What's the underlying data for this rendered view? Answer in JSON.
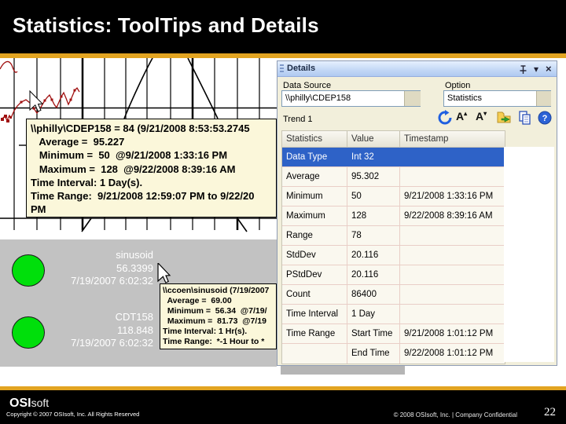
{
  "slide": {
    "title": "Statistics: ToolTips and Details",
    "page_number": "22",
    "footer": {
      "logo_bold": "OSI",
      "logo_light": "soft",
      "copyright": "Copyright © 2007 OSIsoft, Inc. All Rights Reserved",
      "confidential": "© 2008 OSIsoft, Inc.  |  Company Confidential"
    },
    "colors": {
      "accent_gold": "#E2A421",
      "header_bg": "#000000",
      "tooltip_bg": "#FBF7DA",
      "circle_green": "#00DF0B",
      "trend_red": "#A01010",
      "selection_blue": "#2E62C7",
      "panel_bg": "#F2EFDB"
    }
  },
  "trend_tooltip": {
    "lines": [
      "\\\\philly\\CDEP158 = 84 (9/21/2008 8:53:53.2745",
      "   Average =  95.227",
      "   Minimum =  50  @9/21/2008 1:33:16 PM",
      "   Maximum =  128  @9/22/2008 8:39:16 AM",
      "Time Interval: 1 Day(s).",
      "Time Range:  9/21/2008 12:59:07 PM to 9/22/20",
      "PM"
    ]
  },
  "value_tooltip": {
    "lines": [
      "\\\\ccoen\\sinusoid (7/19/2007",
      "  Average =  69.00",
      "  Minimum =  56.34  @7/19/",
      "  Maximum =  81.73  @7/19",
      "Time Interval: 1 Hr(s).",
      "Time Range:  *-1 Hour to *"
    ]
  },
  "values_display": {
    "items": [
      {
        "tag": "sinusoid",
        "value": "56.3399",
        "timestamp": "7/19/2007 6:02:32"
      },
      {
        "tag": "CDT158",
        "value": "118.848",
        "timestamp": "7/19/2007 6:02:32"
      }
    ]
  },
  "details_panel": {
    "title": "Details",
    "window_buttons": {
      "chevron_glyph": "▾",
      "close_glyph": "×"
    },
    "data_source_label": "Data Source",
    "data_source_value": "\\\\philly\\CDEP158",
    "option_label": "Option",
    "option_value": "Statistics",
    "trend_label": "Trend 1",
    "toolbar": {
      "font_letter": "A",
      "font_up_glyph": "▴",
      "font_down_glyph": "▾",
      "help_glyph": "?"
    },
    "table": {
      "columns": [
        "Statistics",
        "Value",
        "Timestamp"
      ],
      "rows": [
        {
          "stat": "Data Type",
          "value": "Int 32",
          "timestamp": ""
        },
        {
          "stat": "Average",
          "value": "95.302",
          "timestamp": ""
        },
        {
          "stat": "Minimum",
          "value": "50",
          "timestamp": "9/21/2008 1:33:16 PM"
        },
        {
          "stat": "Maximum",
          "value": "128",
          "timestamp": "9/22/2008 8:39:16 AM"
        },
        {
          "stat": "Range",
          "value": "78",
          "timestamp": ""
        },
        {
          "stat": "StdDev",
          "value": "20.116",
          "timestamp": ""
        },
        {
          "stat": "PStdDev",
          "value": "20.116",
          "timestamp": ""
        },
        {
          "stat": "Count",
          "value": "86400",
          "timestamp": ""
        },
        {
          "stat": "Time Interval",
          "value": "1 Day",
          "timestamp": ""
        },
        {
          "stat": "Time Range",
          "value": "Start Time",
          "timestamp": "9/21/2008 1:01:12 PM"
        },
        {
          "stat": "",
          "value": "End Time",
          "timestamp": "9/22/2008 1:01:12 PM"
        }
      ]
    }
  }
}
